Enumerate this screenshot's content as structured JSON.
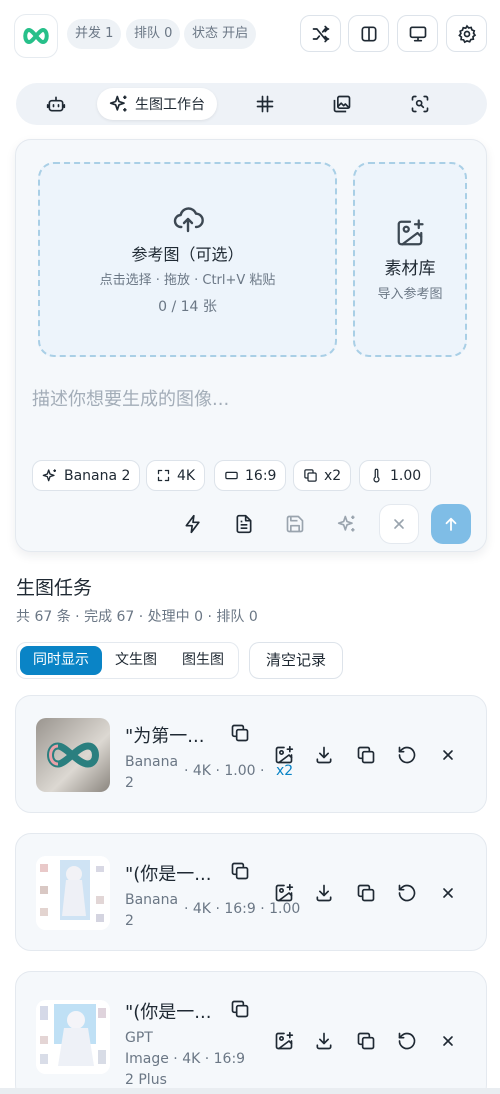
{
  "header": {
    "pills": [
      {
        "label": "并发 1"
      },
      {
        "label": "排队 0"
      },
      {
        "label": "状态 开启"
      }
    ]
  },
  "tabs": {
    "active_label": "生图工作台"
  },
  "composer": {
    "reference": {
      "title": "参考图（可选）",
      "hint": "点击选择 · 拖放 · Ctrl+V 粘贴",
      "count": "0 / 14 张"
    },
    "library": {
      "title": "素材库",
      "hint": "导入参考图"
    },
    "prompt_placeholder": "描述你想要生成的图像...",
    "chips": {
      "model": "Banana 2",
      "resolution": "4K",
      "ratio": "16:9",
      "count": "x2",
      "temperature": "1.00"
    }
  },
  "tasks": {
    "title": "生图任务",
    "summary": "共 67 条 · 完成 67 · 处理中 0 · 排队 0",
    "filters": [
      {
        "label": "同时显示"
      },
      {
        "label": "文生图"
      },
      {
        "label": "图生图"
      }
    ],
    "clear_label": "清空记录",
    "items": [
      {
        "title": "\"为第一...",
        "model_line1": "Banana",
        "model_line2": "2",
        "specs": "· 4K ·  1.00 ·",
        "extra": "x2"
      },
      {
        "title": "\"(你是一...",
        "model_line1": "Banana",
        "model_line2": "2",
        "specs": "· 4K · 16:9 ·  1.00",
        "extra": ""
      },
      {
        "title": "\"(你是一...",
        "model_line1": "GPT",
        "model_line2": "Image · 4K · 16:9",
        "model_line3": "2 Plus",
        "specs": "",
        "extra": ""
      }
    ]
  }
}
